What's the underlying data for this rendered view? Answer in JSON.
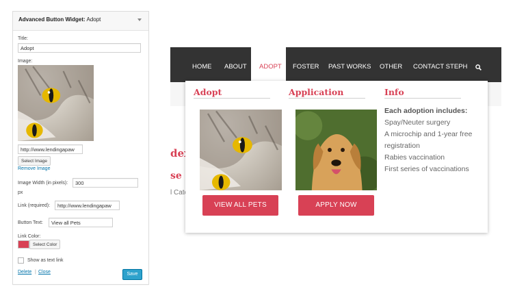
{
  "widget": {
    "title_prefix": "Advanced Button Widget:",
    "title_name": "Adopt",
    "title_label": "Title:",
    "title_value": "Adopt",
    "image_label": "Image:",
    "image_url": "http://www.lendingapaw",
    "select_image": "Select Image",
    "remove_image": "Remove Image",
    "width_label": "Image Width (in pixels):",
    "width_value": "300",
    "width_unit": "px",
    "link_label": "Link (required):",
    "link_value": "http://www.lendingapaw",
    "button_text_label": "Button Text:",
    "button_text_value": "View all Pets",
    "link_color_label": "Link Color:",
    "link_color": "#d84155",
    "select_color": "Select Color",
    "show_text_link": "Show as text link",
    "delete": "Delete",
    "separator": "|",
    "close": "Close",
    "save": "Save"
  },
  "site": {
    "nav": [
      "HOME",
      "ABOUT",
      "ADOPT",
      "FOSTER",
      "PAST WORKS",
      "OTHER",
      "CONTACT STEPH"
    ],
    "active_nav": "ADOPT",
    "accent": "#d84155",
    "nav_bg": "#333333",
    "bg_fragments": [
      "dex",
      "se fo",
      "l Cate"
    ],
    "columns": {
      "adopt": {
        "title": "Adopt",
        "button": "VIEW ALL PETS"
      },
      "application": {
        "title": "Application",
        "button": "APPLY NOW"
      },
      "info": {
        "title": "Info",
        "heading": "Each adoption includes:",
        "lines": [
          "Spay/Neuter surgery",
          "A microchip and 1-year free",
          "registration",
          "Rabies vaccination",
          "First series of vaccinations"
        ]
      }
    }
  }
}
